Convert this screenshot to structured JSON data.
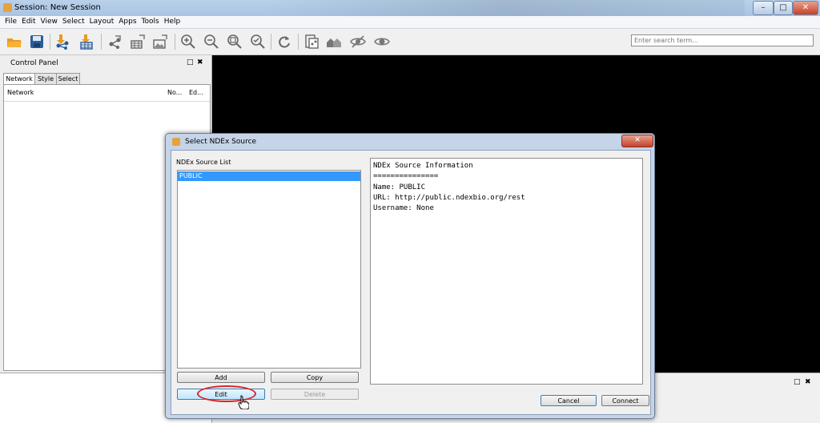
{
  "window": {
    "title": "Session: New Session",
    "controls": {
      "minimize": "–",
      "maximize": "□",
      "close": "✕"
    }
  },
  "menu": [
    "File",
    "Edit",
    "View",
    "Select",
    "Layout",
    "Apps",
    "Tools",
    "Help"
  ],
  "toolbar": {
    "icons": [
      "open-session-icon",
      "save-session-icon",
      "import-network-icon",
      "import-table-icon",
      "export-network-icon",
      "export-table-icon",
      "export-image-icon",
      "zoom-in-icon",
      "zoom-out-icon",
      "zoom-fit-icon",
      "zoom-selected-icon",
      "refresh-icon",
      "new-network-from-selection-icon",
      "first-neighbors-icon",
      "hide-selected-icon",
      "show-all-icon"
    ],
    "search_placeholder": "Enter search term..."
  },
  "control_panel": {
    "title": "Control Panel",
    "float": "□",
    "close": "✖",
    "tabs": [
      "Network",
      "Style",
      "Select"
    ],
    "columns": [
      "Network",
      "No...",
      "Ed..."
    ]
  },
  "results_panel": {
    "float": "□",
    "close": "✖"
  },
  "dialog": {
    "title": "Select NDEx Source",
    "close": "✕",
    "list_label": "NDEx Source List",
    "sources": [
      "PUBLIC"
    ],
    "buttons": {
      "add": "Add",
      "copy": "Copy",
      "edit": "Edit",
      "delete": "Delete",
      "cancel": "Cancel",
      "connect": "Connect"
    },
    "info": "NDEx Source Information\n===============\nName: PUBLIC\nURL: http://public.ndexbio.org/rest\nUsername: None"
  },
  "colors": {
    "selection": "#3399ff",
    "highlight_ring": "#d8232a",
    "canvas": "#000000"
  }
}
